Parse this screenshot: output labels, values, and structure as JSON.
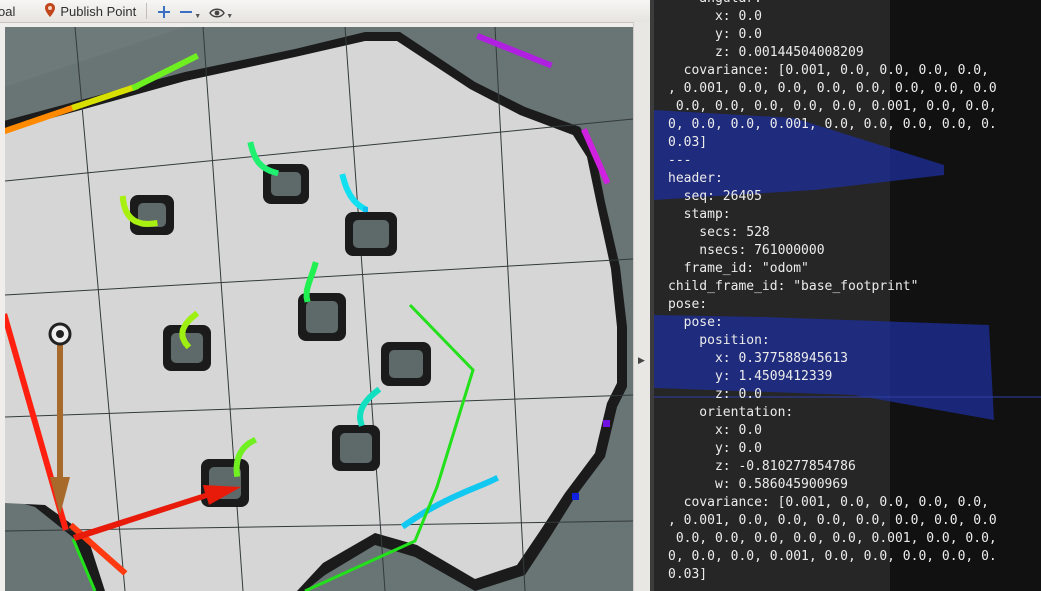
{
  "toolbar": {
    "goal_label": "oal",
    "publish_point_label": "Publish Point",
    "icons": [
      "map-pin-icon",
      "zoom-in-icon",
      "zoom-out-icon",
      "eye-icon"
    ]
  },
  "colors": {
    "map_free": "#d6d6d6",
    "map_unknown": "#697474",
    "map_wall": "#1b1b1b",
    "grid_line": "#333a3a",
    "path_green": "#22e01a",
    "axis_red": "#e81a0a",
    "terminal_bg": "#2d2d2d",
    "terminal_text": "#ececec",
    "laser_blue": "#1e2e99"
  },
  "terminal": {
    "lines": [
      "    angular:",
      "      x: 0.0",
      "      y: 0.0",
      "      z: 0.00144504008209",
      "  covariance: [0.001, 0.0, 0.0, 0.0, 0.0,",
      ", 0.001, 0.0, 0.0, 0.0, 0.0, 0.0, 0.0, 0.0",
      " 0.0, 0.0, 0.0, 0.0, 0.0, 0.001, 0.0, 0.0,",
      "0, 0.0, 0.0, 0.001, 0.0, 0.0, 0.0, 0.0, 0.",
      "0.03]",
      "---",
      "header:",
      "  seq: 26405",
      "  stamp:",
      "    secs: 528",
      "    nsecs: 761000000",
      "  frame_id: \"odom\"",
      "child_frame_id: \"base_footprint\"",
      "pose:",
      "  pose:",
      "    position:",
      "      x: 0.377588945613",
      "      y: 1.4509412339",
      "      z: 0.0",
      "    orientation:",
      "      x: 0.0",
      "      y: 0.0",
      "      z: -0.810277854786",
      "      w: 0.586045900969",
      "  covariance: [0.001, 0.0, 0.0, 0.0, 0.0,",
      ", 0.001, 0.0, 0.0, 0.0, 0.0, 0.0, 0.0, 0.0",
      " 0.0, 0.0, 0.0, 0.0, 0.0, 0.001, 0.0, 0.0,",
      "0, 0.0, 0.0, 0.001, 0.0, 0.0, 0.0, 0.0, 0.",
      "0.03]"
    ]
  }
}
